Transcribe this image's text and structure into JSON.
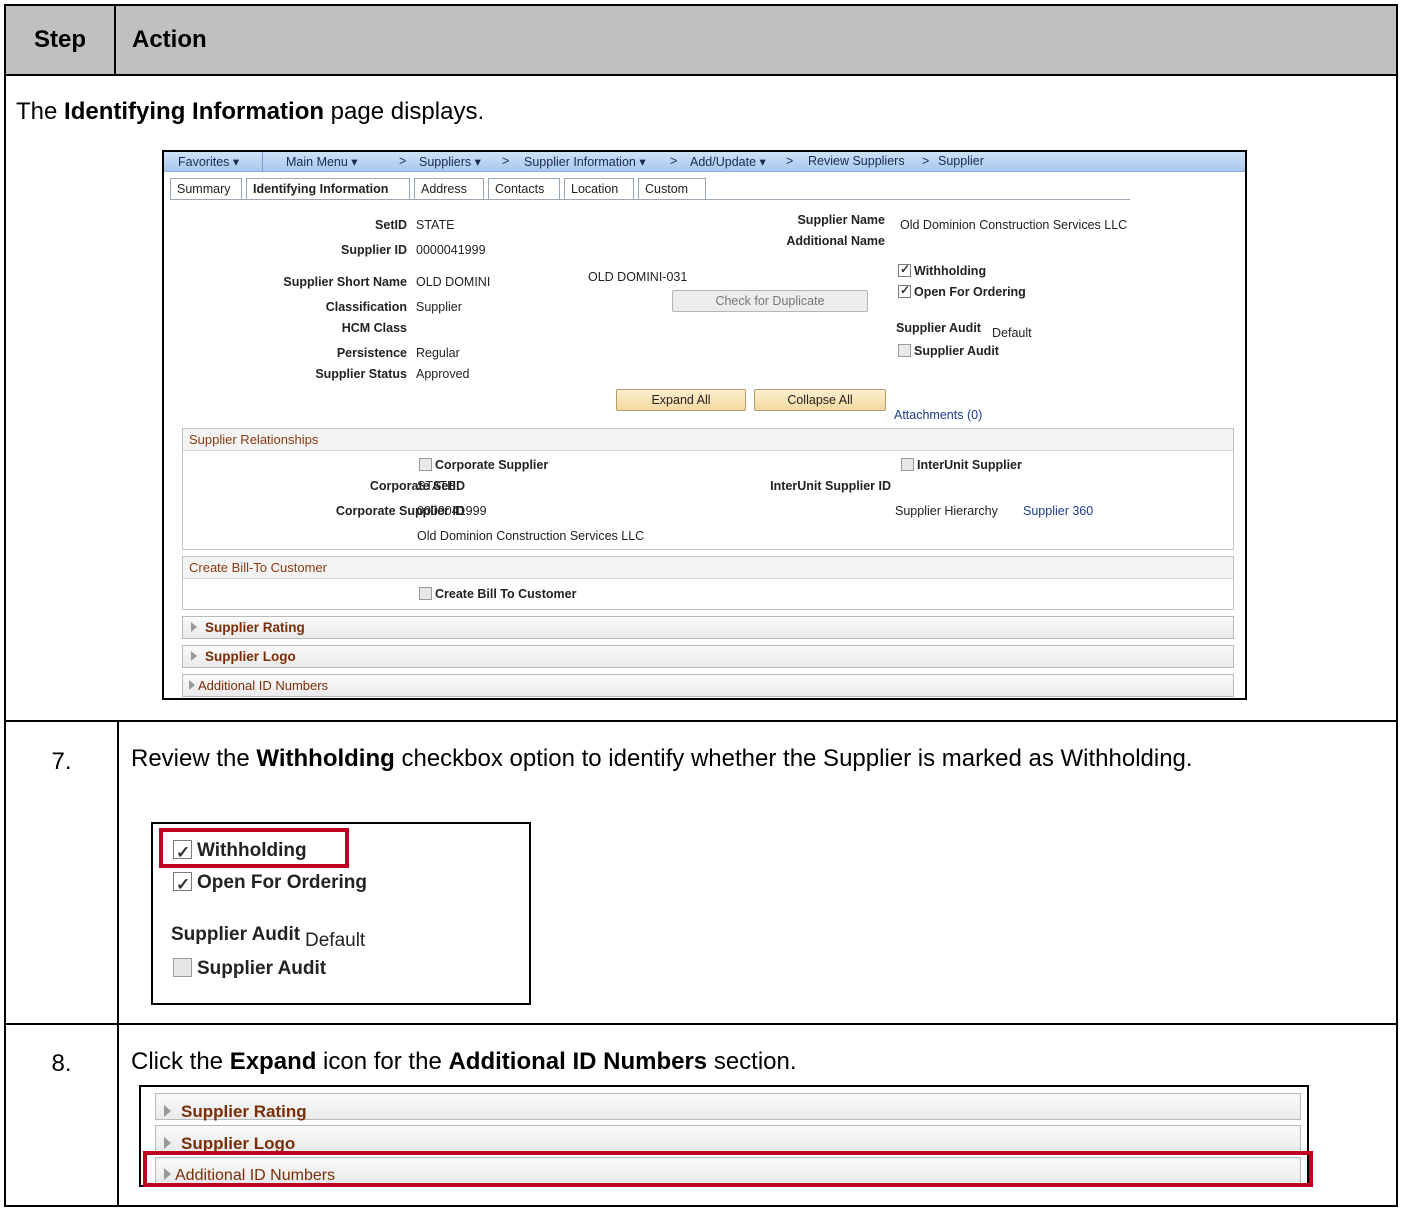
{
  "header": {
    "step": "Step",
    "action": "Action"
  },
  "intro": {
    "prefix": "The ",
    "bold": "Identifying Information",
    "suffix": " page displays."
  },
  "ps": {
    "nav": {
      "favorites": "Favorites ▾",
      "main_menu": "Main Menu ▾",
      "suppliers": "Suppliers ▾",
      "supplier_information": "Supplier Information ▾",
      "add_update": "Add/Update ▾",
      "review_suppliers": "Review Suppliers",
      "supplier": "Supplier",
      "sep": ">"
    },
    "tabs": [
      "Summary",
      "Identifying Information",
      "Address",
      "Contacts",
      "Location",
      "Custom"
    ],
    "fields": {
      "setid_label": "SetID",
      "setid": "STATE",
      "supplier_id_label": "Supplier ID",
      "supplier_id": "0000041999",
      "short_name_label": "Supplier Short Name",
      "short_name": "OLD DOMINI",
      "short_name_seq": "OLD DOMINI-031",
      "classification_label": "Classification",
      "classification": "Supplier",
      "hcm_class_label": "HCM Class",
      "persistence_label": "Persistence",
      "persistence": "Regular",
      "status_label": "Supplier Status",
      "status": "Approved",
      "supplier_name_label": "Supplier Name",
      "supplier_name": "Old Dominion Construction Services LLC",
      "additional_name_label": "Additional Name",
      "withholding": "Withholding",
      "open_for_ordering": "Open For Ordering",
      "supplier_audit_label": "Supplier Audit",
      "supplier_audit_value": "Default",
      "supplier_audit_cb": "Supplier Audit"
    },
    "buttons": {
      "check_duplicate": "Check for Duplicate",
      "expand_all": "Expand All",
      "collapse_all": "Collapse All",
      "attachments": "Attachments (0)"
    },
    "relationships": {
      "title": "Supplier Relationships",
      "corporate_supplier": "Corporate Supplier",
      "interunit_supplier": "InterUnit Supplier",
      "corporate_setid_label": "Corporate SetID",
      "corporate_setid": "STATE",
      "interunit_id_label": "InterUnit Supplier ID",
      "corporate_supplier_id_label": "Corporate Supplier ID",
      "corporate_supplier_id": "0000041999",
      "hierarchy_label": "Supplier Hierarchy",
      "supplier_360": "Supplier 360",
      "corporate_name": "Old Dominion Construction Services LLC"
    },
    "bill_to": {
      "title": "Create Bill-To Customer",
      "checkbox": "Create Bill To Customer"
    },
    "sections": {
      "rating": "Supplier Rating",
      "logo": "Supplier Logo",
      "additional_ids": "Additional ID Numbers"
    }
  },
  "step7": {
    "number": "7.",
    "t1": "Review the ",
    "b1": "Withholding",
    "t2": " checkbox option to identify whether the Supplier is marked as Withholding.",
    "zoom": {
      "withholding": "Withholding",
      "open_for_ordering": "Open For Ordering",
      "audit_label": "Supplier Audit",
      "audit_value": "Default",
      "audit_cb": "Supplier Audit"
    }
  },
  "step8": {
    "number": "8.",
    "t1": "Click the ",
    "b1": "Expand",
    "t2": " icon for the ",
    "b2": "Additional ID Numbers",
    "t3": " section.",
    "zoom": {
      "rating": "Supplier Rating",
      "logo": "Supplier Logo",
      "additional_ids": "Additional ID Numbers"
    }
  },
  "colors": {
    "header_bg": "#c0c0c0",
    "highlight": "#c00020",
    "section_text": "#7a2e08",
    "nav_bg": "#b8d2f0"
  }
}
